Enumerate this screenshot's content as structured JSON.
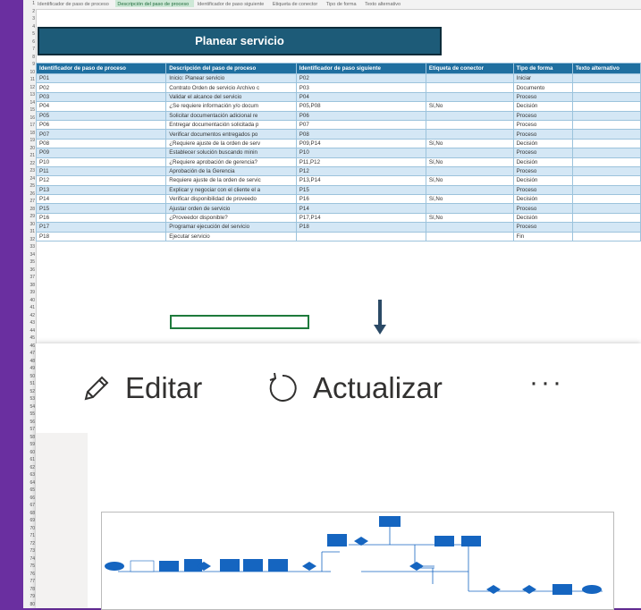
{
  "spreadsheet": {
    "column_headers": [
      "Identificador de paso de proceso",
      "Descripción del paso de proceso",
      "Identificador de paso siguiente",
      "Etiqueta de conector",
      "Tipo de forma",
      "Texto alternativo"
    ],
    "title": "Planear servicio",
    "table_headers": [
      "Identificador de paso de proceso",
      "Descripción del paso de proceso",
      "Identificador de paso siguiente",
      "Etiqueta de conector",
      "Tipo de forma",
      "Texto alternativo"
    ],
    "rows": [
      [
        "P01",
        "Inicio: Planear servicio",
        "P02",
        "",
        "Iniciar",
        ""
      ],
      [
        "P02",
        "Contrato Orden de servicio Archivo c",
        "P03",
        "",
        "Documento",
        ""
      ],
      [
        "P03",
        "Validar el alcance del servicio",
        "P04",
        "",
        "Proceso",
        ""
      ],
      [
        "P04",
        "¿Se requiere información y/o docum",
        "P05,P08",
        "Sí,No",
        "Decisión",
        ""
      ],
      [
        "P05",
        "Solicitar documentación adicional re",
        "P06",
        "",
        "Proceso",
        ""
      ],
      [
        "P06",
        "Entregar documentación solicitada p",
        "P07",
        "",
        "Proceso",
        ""
      ],
      [
        "P07",
        "Verificar documentos entregados po",
        "P08",
        "",
        "Proceso",
        ""
      ],
      [
        "P08",
        "¿Requiere ajuste de la orden de serv",
        "P09,P14",
        "Sí,No",
        "Decisión",
        ""
      ],
      [
        "P09",
        "Establecer solución buscando minin",
        "P10",
        "",
        "Proceso",
        ""
      ],
      [
        "P10",
        "¿Requiere aprobación de gerencia?",
        "P11,P12",
        "Sí,No",
        "Decisión",
        ""
      ],
      [
        "P11",
        "Aprobación de la Gerencia",
        "P12",
        "",
        "Proceso",
        ""
      ],
      [
        "P12",
        "Requiere ajuste de la orden de servic",
        "P13,P14",
        "Sí,No",
        "Decisión",
        ""
      ],
      [
        "P13",
        "Explicar y negociar con el cliente el a",
        "P15",
        "",
        "Proceso",
        ""
      ],
      [
        "P14",
        "Verificar disponibilidad de proveedo",
        "P16",
        "Sí,No",
        "Decisión",
        ""
      ],
      [
        "P15",
        "Ajustar orden de servicio",
        "P14",
        "",
        "Proceso",
        ""
      ],
      [
        "P16",
        "¿Proveedor disponible?",
        "P17,P14",
        "Sí,No",
        "Decisión",
        ""
      ],
      [
        "P17",
        "Programar ejecución del servicio",
        "P18",
        "",
        "Proceso",
        ""
      ],
      [
        "P18",
        "Ejecutar servicio",
        "",
        "",
        "Fin",
        ""
      ]
    ],
    "row_numbers": [
      "1",
      "2",
      "3",
      "4",
      "5",
      "6",
      "7",
      "8",
      "9",
      "10",
      "11",
      "12",
      "13",
      "14",
      "15",
      "16",
      "17",
      "18",
      "19",
      "20",
      "21",
      "22",
      "23",
      "24",
      "25",
      "26",
      "27",
      "28",
      "29",
      "30",
      "31",
      "32",
      "33",
      "34",
      "35",
      "36",
      "37",
      "38",
      "39",
      "40",
      "41",
      "42",
      "43",
      "44",
      "45",
      "46",
      "47",
      "48",
      "49",
      "50",
      "51",
      "52",
      "53",
      "54",
      "55",
      "56",
      "57",
      "58",
      "59",
      "60",
      "61",
      "62",
      "63",
      "64",
      "65",
      "66",
      "67",
      "68",
      "69",
      "70",
      "71",
      "72",
      "73",
      "74",
      "75",
      "76",
      "77",
      "78",
      "79",
      "80"
    ]
  },
  "toolbar": {
    "edit_label": "Editar",
    "refresh_label": "Actualizar",
    "more_label": "···"
  },
  "colors": {
    "background": "#6a2fa0",
    "header_blue": "#1f6fa0",
    "band_blue": "#d4e7f5",
    "shape_blue": "#1565c0"
  }
}
